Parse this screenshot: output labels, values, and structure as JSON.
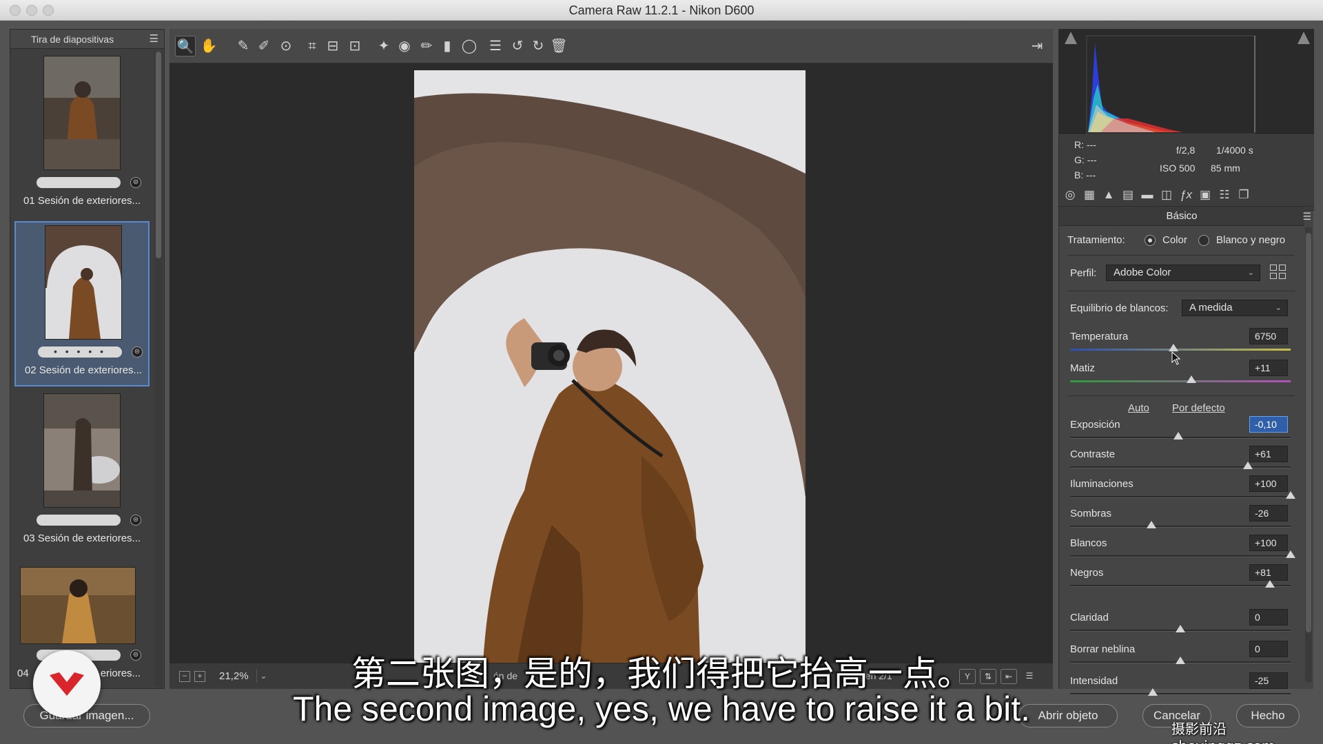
{
  "window": {
    "title": "Camera Raw 11.2.1 -  Nikon D600"
  },
  "filmstrip": {
    "header": "Tira de diapositivas",
    "items": [
      {
        "label": "01 Sesión de exteriores...",
        "rating": "",
        "selected": false
      },
      {
        "label": "02 Sesión de exteriores...",
        "rating": "• • • • •",
        "selected": true
      },
      {
        "label": "03 Sesión de exteriores...",
        "rating": "",
        "selected": false
      },
      {
        "label": "04",
        "label_tail": "eriores...",
        "rating": "",
        "selected": false
      }
    ]
  },
  "toolbar": {
    "tools": [
      {
        "icon": "zoom-icon",
        "glyph": "🔍"
      },
      {
        "icon": "hand-icon",
        "glyph": "✋"
      },
      {
        "icon": "white-balance-icon",
        "glyph": "✎"
      },
      {
        "icon": "color-sampler-icon",
        "glyph": "✐"
      },
      {
        "icon": "target-adjust-icon",
        "glyph": "⊙"
      },
      {
        "icon": "crop-icon",
        "glyph": "⌗"
      },
      {
        "icon": "straighten-icon",
        "glyph": "⊟"
      },
      {
        "icon": "transform-icon",
        "glyph": "⊡"
      },
      {
        "icon": "spot-removal-icon",
        "glyph": "✦"
      },
      {
        "icon": "red-eye-icon",
        "glyph": "◉"
      },
      {
        "icon": "adjustment-brush-icon",
        "glyph": "✏"
      },
      {
        "icon": "graduated-filter-icon",
        "glyph": "▮"
      },
      {
        "icon": "radial-filter-icon",
        "glyph": "◯"
      },
      {
        "icon": "preferences-icon",
        "glyph": "☰"
      },
      {
        "icon": "rotate-left-icon",
        "glyph": "↺"
      },
      {
        "icon": "rotate-right-icon",
        "glyph": "↻"
      },
      {
        "icon": "delete-icon",
        "glyph": "🗑"
      }
    ],
    "fullscreen_glyph": "⇥"
  },
  "statusbar": {
    "zoom": "21,2%",
    "zoom_minus": "−",
    "zoom_plus": "+",
    "info": "ón de",
    "count": "gen 2/1"
  },
  "info": {
    "r_label": "R:",
    "g_label": "G:",
    "b_label": "B:",
    "r": "---",
    "g": "---",
    "b": "---",
    "aperture": "f/2,8",
    "shutter": "1/4000 s",
    "iso": "ISO 500",
    "focal": "85 mm"
  },
  "panel": {
    "title": "Básico",
    "treatment_label": "Tratamiento:",
    "treatment_color": "Color",
    "treatment_bw": "Blanco y negro",
    "profile_label": "Perfil:",
    "profile_value": "Adobe Color",
    "wb_label": "Equilibrio de blancos:",
    "wb_value": "A medida",
    "auto": "Auto",
    "default": "Por defecto",
    "sliders": [
      {
        "name": "temperatura",
        "label": "Temperatura",
        "value": "6750",
        "pos": 0.47,
        "track": "temp"
      },
      {
        "name": "matiz",
        "label": "Matiz",
        "value": "+11",
        "pos": 0.55,
        "track": "tint"
      },
      {
        "name": "exposicion",
        "label": "Exposición",
        "value": "-0,10",
        "pos": 0.49,
        "focus": true
      },
      {
        "name": "contraste",
        "label": "Contraste",
        "value": "+61",
        "pos": 0.805
      },
      {
        "name": "iluminaciones",
        "label": "Iluminaciones",
        "value": "+100",
        "pos": 1.0
      },
      {
        "name": "sombras",
        "label": "Sombras",
        "value": "-26",
        "pos": 0.37
      },
      {
        "name": "blancos",
        "label": "Blancos",
        "value": "+100",
        "pos": 1.0
      },
      {
        "name": "negros",
        "label": "Negros",
        "value": "+81",
        "pos": 0.905
      },
      {
        "name": "claridad",
        "label": "Claridad",
        "value": "0",
        "pos": 0.5
      },
      {
        "name": "borrar-neblina",
        "label": "Borrar neblina",
        "value": "0",
        "pos": 0.5
      },
      {
        "name": "intensidad",
        "label": "Intensidad",
        "value": "-25",
        "pos": 0.375
      }
    ]
  },
  "footer": {
    "save": "Guardar imagen...",
    "open": "Abrir objeto",
    "cancel": "Cancelar",
    "done": "Hecho"
  },
  "subtitles": {
    "cn": "第二张图，是的，我们得把它抬高一点。",
    "en": "The second image, yes, we have to raise it a bit."
  },
  "watermark": "摄影前沿 sheyingqz.com",
  "colors": {
    "accent": "#2f5fa8",
    "selection": "#5a8acf",
    "logo": "#d9262c"
  }
}
